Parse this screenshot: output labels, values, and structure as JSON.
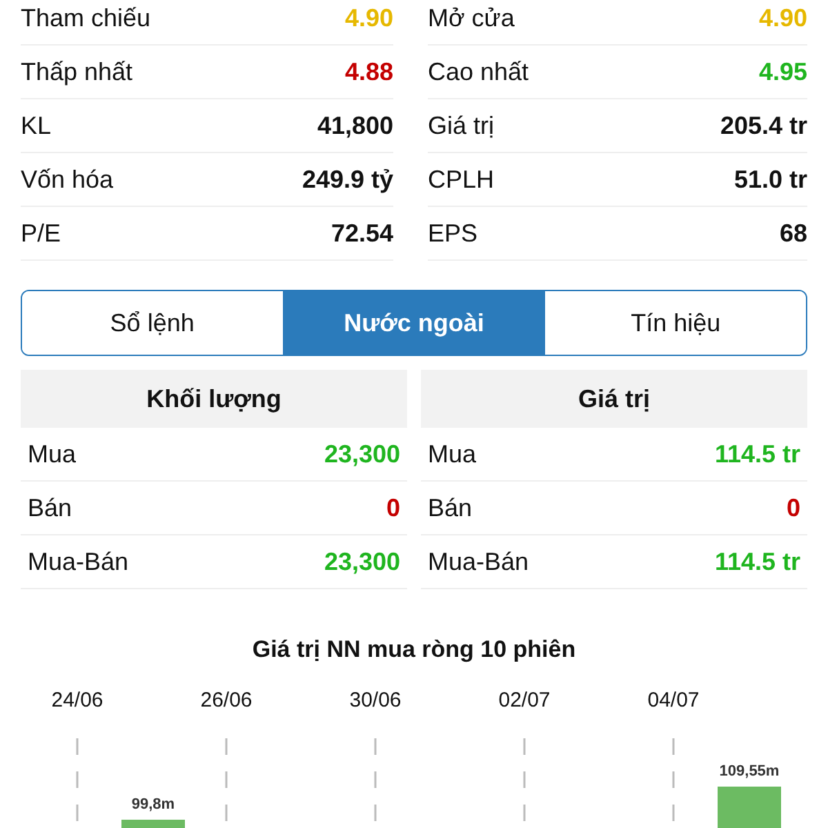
{
  "stats": [
    {
      "label": "Tham chiếu",
      "value": "4.90",
      "color": "#e6b800"
    },
    {
      "label": "Mở cửa",
      "value": "4.90",
      "color": "#e6b800"
    },
    {
      "label": "Thấp nhất",
      "value": "4.88",
      "color": "#c40000"
    },
    {
      "label": "Cao nhất",
      "value": "4.95",
      "color": "#1fb51f"
    },
    {
      "label": "KL",
      "value": "41,800",
      "color": "#111111"
    },
    {
      "label": "Giá trị",
      "value": "205.4 tr",
      "color": "#111111"
    },
    {
      "label": "Vốn hóa",
      "value": "249.9 tỷ",
      "color": "#111111"
    },
    {
      "label": "CPLH",
      "value": "51.0 tr",
      "color": "#111111"
    },
    {
      "label": "P/E",
      "value": "72.54",
      "color": "#111111"
    },
    {
      "label": "EPS",
      "value": "68",
      "color": "#111111"
    }
  ],
  "tabs": [
    {
      "label": "Sổ lệnh",
      "selected": false
    },
    {
      "label": "Nước ngoài",
      "selected": true
    },
    {
      "label": "Tín hiệu",
      "selected": false
    }
  ],
  "foreign": [
    {
      "heading": "Khối lượng",
      "rows": [
        {
          "label": "Mua",
          "value": "23,300",
          "color": "#1fb51f"
        },
        {
          "label": "Bán",
          "value": "0",
          "color": "#c40000"
        },
        {
          "label": "Mua-Bán",
          "value": "23,300",
          "color": "#1fb51f"
        }
      ]
    },
    {
      "heading": "Giá trị",
      "rows": [
        {
          "label": "Mua",
          "value": "114.5 tr",
          "color": "#1fb51f"
        },
        {
          "label": "Bán",
          "value": "0",
          "color": "#c40000"
        },
        {
          "label": "Mua-Bán",
          "value": "114.5 tr",
          "color": "#1fb51f"
        }
      ]
    }
  ],
  "chart": {
    "title": "Giá trị NN mua ròng 10 phiên",
    "dates": [
      "24/06",
      "26/06",
      "30/06",
      "02/07",
      "04/07"
    ],
    "bars": [
      {
        "label": "99,8m"
      },
      {
        "label": "109,55m"
      }
    ]
  }
}
